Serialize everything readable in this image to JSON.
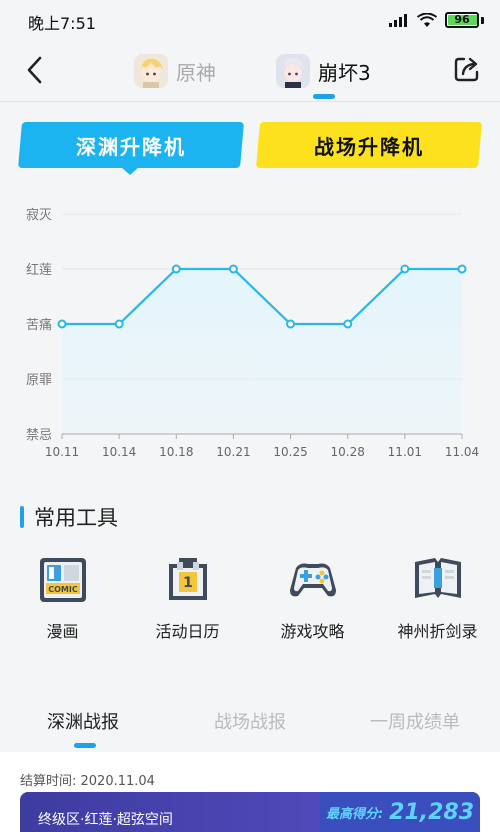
{
  "status": {
    "time": "晚上7:51",
    "battery": "96"
  },
  "nav": {
    "games": [
      {
        "label": "原神"
      },
      {
        "label": "崩坏3"
      }
    ]
  },
  "modes": {
    "abyss": "深渊升降机",
    "battlefield": "战场升降机"
  },
  "chart_data": {
    "type": "line",
    "categories": [
      "10.11",
      "10.14",
      "10.18",
      "10.21",
      "10.25",
      "10.28",
      "11.01",
      "11.04"
    ],
    "y_levels": [
      "禁忌",
      "原罪",
      "苦痛",
      "红莲",
      "寂灭"
    ],
    "values": [
      2,
      2,
      3,
      3,
      2,
      2,
      3,
      3
    ],
    "ylim": [
      0,
      4
    ],
    "line_color": "#29b6e8",
    "fill_color": "#e3f5fc",
    "grid": true
  },
  "tools": {
    "title": "常用工具",
    "items": [
      {
        "label": "漫画",
        "icon": "comic-icon"
      },
      {
        "label": "活动日历",
        "icon": "calendar-icon"
      },
      {
        "label": "游戏攻略",
        "icon": "gamepad-icon"
      },
      {
        "label": "神州折剑录",
        "icon": "book-icon"
      }
    ]
  },
  "reports": {
    "tabs": [
      "深渊战报",
      "战场战报",
      "一周成绩单"
    ],
    "settle_time": "结算时间: 2020.11.04",
    "zone": "终级区·红莲·超弦空间",
    "score_label": "最高得分:",
    "score_value": "21,283"
  }
}
